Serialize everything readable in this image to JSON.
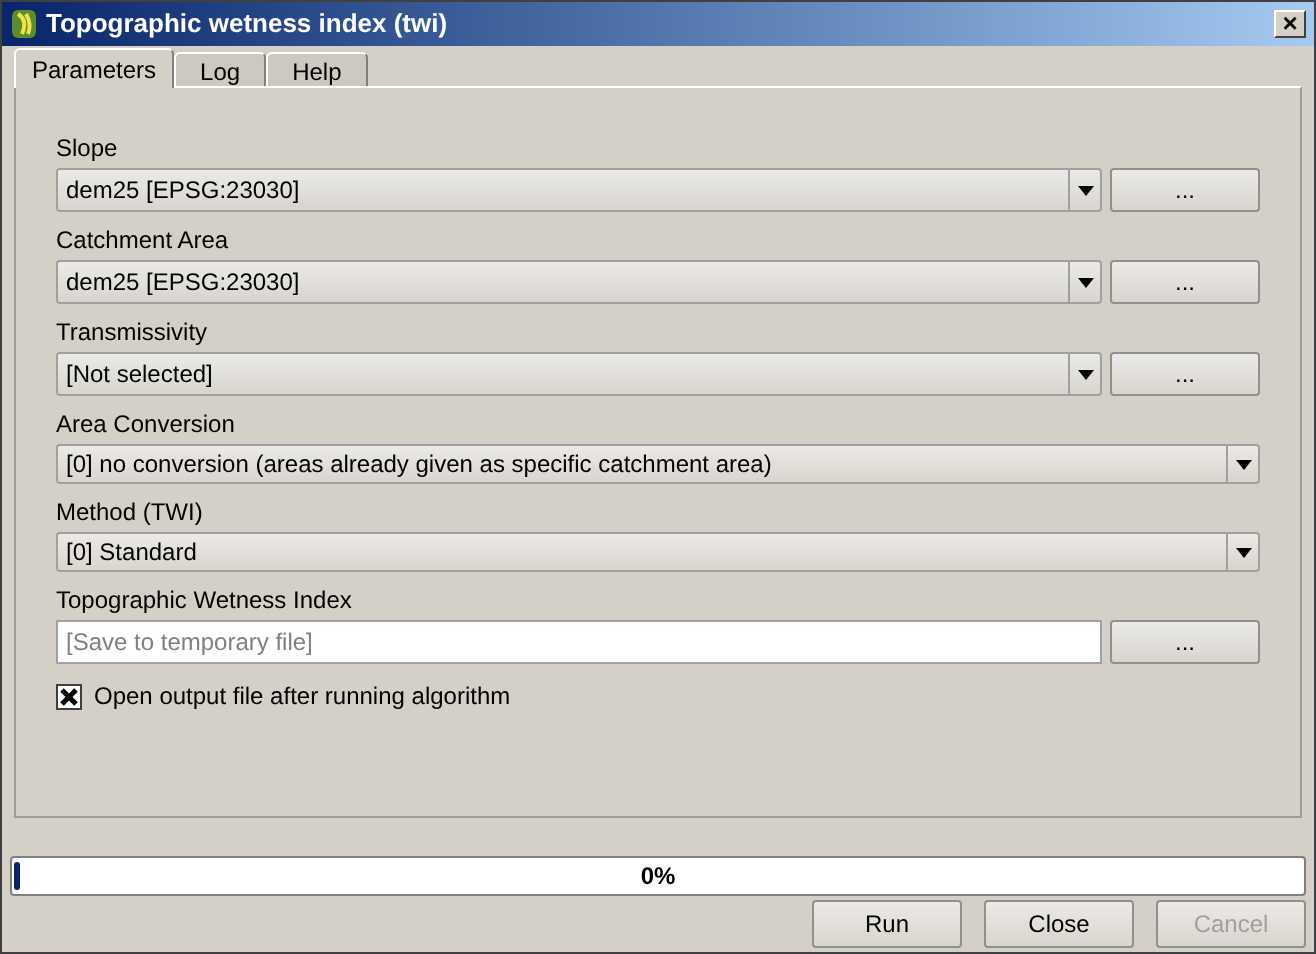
{
  "window": {
    "title": "Topographic wetness index (twi)",
    "close": "×"
  },
  "tabs": [
    {
      "label": "Parameters",
      "selected": true
    },
    {
      "label": "Log",
      "selected": false
    },
    {
      "label": "Help",
      "selected": false
    }
  ],
  "parameters": [
    {
      "kind": "combo_browse",
      "label": "Slope",
      "value": "dem25 [EPSG:23030]",
      "browse": "..."
    },
    {
      "kind": "combo_browse",
      "label": "Catchment Area",
      "value": "dem25 [EPSG:23030]",
      "browse": "..."
    },
    {
      "kind": "combo_browse",
      "label": "Transmissivity",
      "value": "[Not selected]",
      "browse": "..."
    },
    {
      "kind": "combo",
      "label": "Area Conversion",
      "value": "[0] no conversion (areas already given as specific catchment area)"
    },
    {
      "kind": "combo",
      "label": "Method (TWI)",
      "value": "[0] Standard"
    },
    {
      "kind": "file",
      "label": "Topographic Wetness Index",
      "placeholder": "[Save to temporary file]",
      "browse": "..."
    }
  ],
  "open_output": {
    "label": "Open output file after running algorithm",
    "checked": true
  },
  "progress": {
    "level": 0,
    "reading": "0%"
  },
  "buttons": [
    {
      "label": "Run",
      "enabled": true
    },
    {
      "label": "Close",
      "enabled": true
    },
    {
      "label": "Cancel",
      "enabled": false
    }
  ]
}
